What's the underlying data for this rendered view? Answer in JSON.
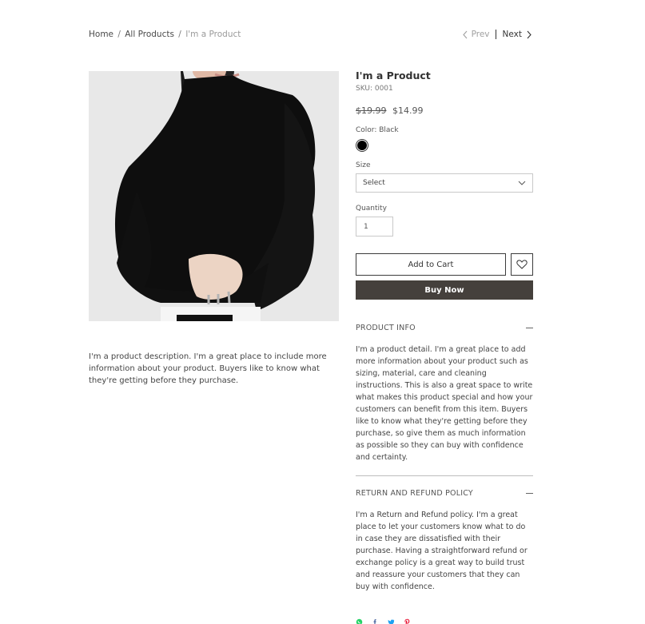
{
  "breadcrumb": {
    "home": "Home",
    "all_products": "All Products",
    "current": "I'm a Product",
    "separator": "/"
  },
  "pager": {
    "prev": "Prev",
    "next": "Next"
  },
  "product": {
    "title": "I'm a Product",
    "sku": "SKU: 0001",
    "old_price": "$19.99",
    "price": "$14.99",
    "color_label": "Color: Black",
    "color_value": "#000000",
    "size_label": "Size",
    "size_placeholder": "Select",
    "quantity_label": "Quantity",
    "quantity_value": "1",
    "add_to_cart": "Add to Cart",
    "buy_now": "Buy Now",
    "description": "I'm a product description. I'm a great place to include more information about your product. Buyers like to know what they're getting before they purchase."
  },
  "accordion": [
    {
      "title": "PRODUCT INFO",
      "body": "I'm a product detail. I'm a great place to add more information about your product such as sizing, material, care and cleaning instructions. This is also a great space to write what makes this product special and how your customers can benefit from this item. Buyers like to know what they're getting before they purchase, so give them as much information as possible so they can buy with confidence and certainty."
    },
    {
      "title": "RETURN AND REFUND POLICY",
      "body": "I'm a Return and Refund policy. I'm a great place to let your customers know what to do in case they are dissatisfied with their purchase. Having a straightforward refund or exchange policy is a great way to build trust and reassure your customers that they can buy with confidence."
    }
  ],
  "share": [
    "whatsapp-icon",
    "facebook-icon",
    "twitter-icon",
    "pinterest-icon"
  ],
  "colors": {
    "buy_now_bg": "#45403c",
    "text": "#3b3b3b",
    "whatsapp": "#25d366",
    "facebook": "#3b5998",
    "twitter": "#1da1f2",
    "pinterest": "#e60023"
  }
}
